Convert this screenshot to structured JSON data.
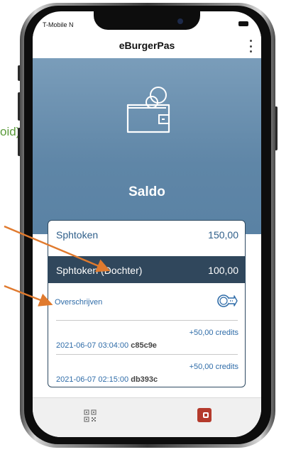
{
  "side_text": "oid)",
  "status_bar": {
    "carrier": "T-Mobile N"
  },
  "app": {
    "title": "eBurgerPas"
  },
  "hero": {
    "heading": "Saldo"
  },
  "balances": [
    {
      "name": "Sphtoken",
      "amount": "150,00"
    },
    {
      "name": "Sphtoken (Dochter)",
      "amount": "100,00"
    }
  ],
  "transfer": {
    "label": "Overschrijven",
    "icon": "coin-transfer-icon"
  },
  "transactions": [
    {
      "datetime": "2021-06-07 03:04:00",
      "code": "c85c9e",
      "amount": "+50,00 credits"
    },
    {
      "datetime": "2021-06-07 02:15:00",
      "code": "db393c",
      "amount": "+50,00 credits"
    }
  ],
  "bottom_nav": {
    "items": [
      {
        "icon": "qr-code-icon"
      },
      {
        "icon": "wallet-icon"
      }
    ]
  },
  "colors": {
    "hero": "#6a90b0",
    "selected_row": "#30475c",
    "accent": "#b43a2c",
    "arrow": "#e07a2e",
    "link": "#2f6ca8"
  }
}
